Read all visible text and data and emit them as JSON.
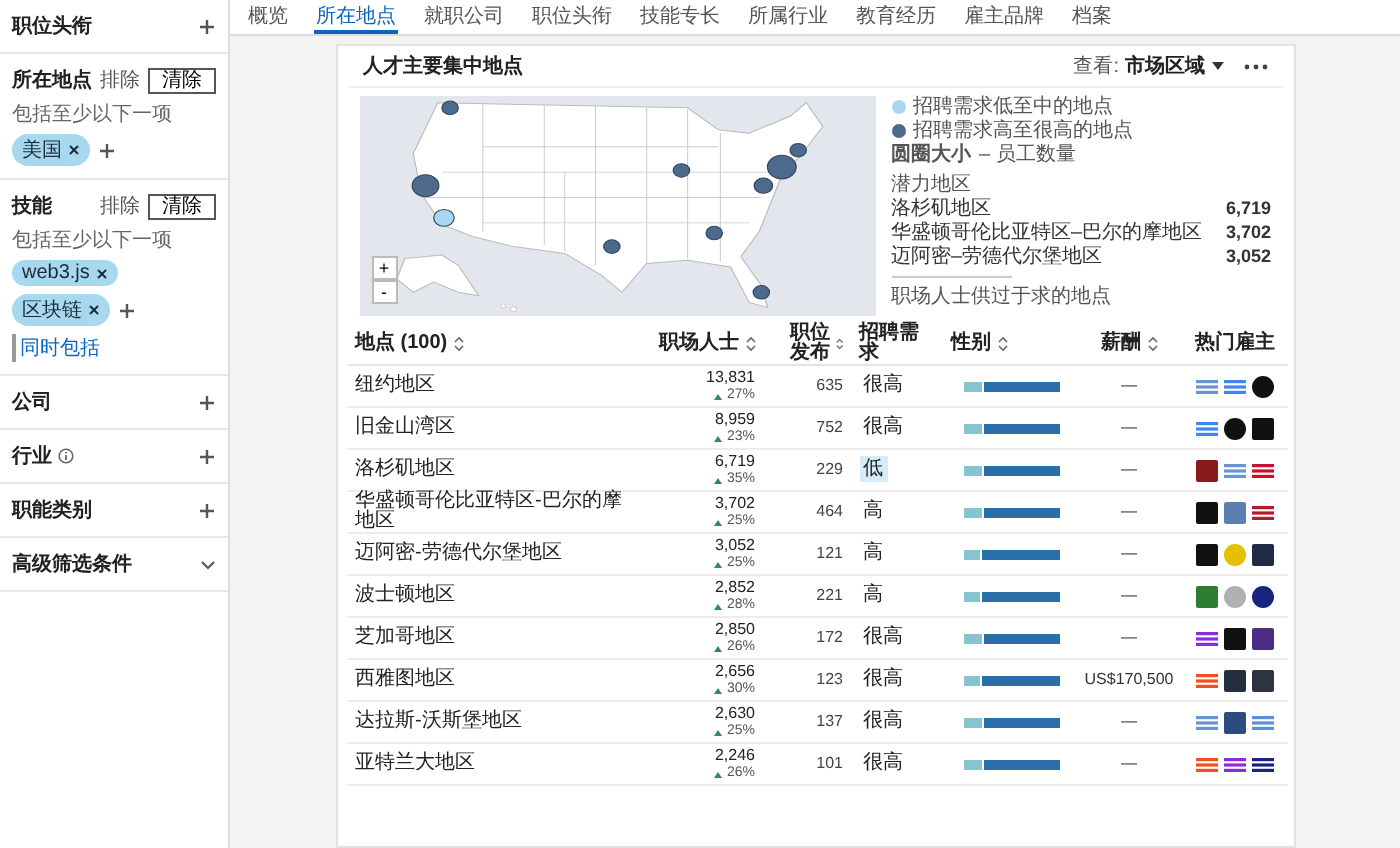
{
  "sidebar": {
    "sections": [
      {
        "kind": "add",
        "title": "职位头衔",
        "info": false
      },
      {
        "kind": "filter",
        "title": "所在地点",
        "exclude": "排除",
        "clear": "清除",
        "hint": "包括至少以下一项",
        "chips": [
          "美国"
        ]
      },
      {
        "kind": "filter",
        "title": "技能",
        "exclude": "排除",
        "clear": "清除",
        "hint": "包括至少以下一项",
        "chips": [
          "web3.js",
          "区块链"
        ],
        "also": "同时包括"
      },
      {
        "kind": "add",
        "title": "公司",
        "info": false
      },
      {
        "kind": "add",
        "title": "行业",
        "info": true
      },
      {
        "kind": "add",
        "title": "职能类别",
        "info": false
      },
      {
        "kind": "more",
        "title": "高级筛选条件"
      }
    ]
  },
  "tabs": [
    {
      "label": "概览",
      "selected": false
    },
    {
      "label": "所在地点",
      "selected": true
    },
    {
      "label": "就职公司",
      "selected": false
    },
    {
      "label": "职位头衔",
      "selected": false
    },
    {
      "label": "技能专长",
      "selected": false
    },
    {
      "label": "所属行业",
      "selected": false
    },
    {
      "label": "教育经历",
      "selected": false
    },
    {
      "label": "雇主品牌",
      "selected": false
    },
    {
      "label": "档案",
      "selected": false
    }
  ],
  "card": {
    "title": "人才主要集中地点",
    "view_label": "查看:",
    "view_value": "市场区域",
    "map": {
      "zoom_in": "+",
      "zoom_out": "-"
    },
    "legend": [
      {
        "label": "招聘需求低至中的地点",
        "color": "#a9d6f0"
      },
      {
        "label": "招聘需求高至很高的地点",
        "color": "#4d6a8c"
      }
    ],
    "size_note": "**圆圈大小** – 员工数量",
    "potential_title": "潜力地区",
    "potential": [
      {
        "name": "洛杉矶地区",
        "value": "6,719"
      },
      {
        "name": "华盛顿哥伦比亚特区–巴尔的摩地区",
        "value": "3,702"
      },
      {
        "name": "迈阿密–劳德代尔堡地区",
        "value": "3,052"
      }
    ],
    "oversupply": "职场人士供过于求的地点"
  },
  "table": {
    "columns": [
      {
        "label": "地点 (100)",
        "sortable": true
      },
      {
        "label": "职场人士",
        "sortable": true
      },
      {
        "label": "职位发布",
        "sortable": true
      },
      {
        "label": "招聘需求",
        "sortable": false
      },
      {
        "label": "性别",
        "sortable": true
      },
      {
        "label": "薪酬",
        "sortable": true
      },
      {
        "label": "热门雇主",
        "sortable": false
      }
    ],
    "rows": [
      {
        "location": "纽约地区",
        "professionals": "13,831",
        "change": "27%",
        "postings": "635",
        "demand": "很高",
        "highlighted": false,
        "level": 0.2,
        "salary": "—",
        "employers": [
          {
            "kind": "mark",
            "color": "#6b94d6"
          },
          {
            "kind": "mark",
            "color": "#4285f4"
          },
          {
            "kind": "round",
            "color": "#111111"
          }
        ]
      },
      {
        "location": "旧金山湾区",
        "professionals": "8,959",
        "change": "23%",
        "postings": "752",
        "demand": "很高",
        "highlighted": false,
        "level": 0.2,
        "salary": "—",
        "employers": [
          {
            "kind": "mark",
            "color": "#4285f4"
          },
          {
            "kind": "round",
            "color": "#111111"
          },
          {
            "kind": "tile",
            "color": "#111111"
          }
        ]
      },
      {
        "location": "洛杉矶地区",
        "professionals": "6,719",
        "change": "35%",
        "postings": "229",
        "demand": "低",
        "highlighted": true,
        "level": 0.2,
        "salary": "—",
        "employers": [
          {
            "kind": "tile",
            "color": "#8b1a1a"
          },
          {
            "kind": "mark",
            "color": "#6b94d6"
          },
          {
            "kind": "mark",
            "color": "#c8102e"
          }
        ]
      },
      {
        "location": "华盛顿哥伦比亚特区-巴尔的摩地区",
        "professionals": "3,702",
        "change": "25%",
        "postings": "464",
        "demand": "高",
        "highlighted": false,
        "level": 0.2,
        "salary": "—",
        "employers": [
          {
            "kind": "tile",
            "color": "#111111"
          },
          {
            "kind": "tile",
            "color": "#5a7fb0"
          },
          {
            "kind": "mark",
            "color": "#b01c2e"
          }
        ]
      },
      {
        "location": "迈阿密-劳德代尔堡地区",
        "professionals": "3,052",
        "change": "25%",
        "postings": "121",
        "demand": "高",
        "highlighted": false,
        "level": 0.17,
        "salary": "—",
        "employers": [
          {
            "kind": "tile",
            "color": "#111111"
          },
          {
            "kind": "round",
            "color": "#e6bf00"
          },
          {
            "kind": "tile",
            "color": "#1f2a44"
          }
        ]
      },
      {
        "location": "波士顿地区",
        "professionals": "2,852",
        "change": "28%",
        "postings": "221",
        "demand": "高",
        "highlighted": false,
        "level": 0.17,
        "salary": "—",
        "employers": [
          {
            "kind": "tile",
            "color": "#2e7d32"
          },
          {
            "kind": "round",
            "color": "#b0b0b0"
          },
          {
            "kind": "round",
            "color": "#1a237e"
          }
        ]
      },
      {
        "location": "芝加哥地区",
        "professionals": "2,850",
        "change": "26%",
        "postings": "172",
        "demand": "很高",
        "highlighted": false,
        "level": 0.2,
        "salary": "—",
        "employers": [
          {
            "kind": "mark",
            "color": "#8a2be2"
          },
          {
            "kind": "tile",
            "color": "#111111"
          },
          {
            "kind": "tile",
            "color": "#4b2e83"
          }
        ]
      },
      {
        "location": "西雅图地区",
        "professionals": "2,656",
        "change": "30%",
        "postings": "123",
        "demand": "很高",
        "highlighted": false,
        "level": 0.17,
        "salary": "US$170,500",
        "employers": [
          {
            "kind": "mark",
            "color": "#f25022"
          },
          {
            "kind": "tile",
            "color": "#232f3e"
          },
          {
            "kind": "tile",
            "color": "#2b3440"
          }
        ]
      },
      {
        "location": "达拉斯-沃斯堡地区",
        "professionals": "2,630",
        "change": "25%",
        "postings": "137",
        "demand": "很高",
        "highlighted": false,
        "level": 0.2,
        "salary": "—",
        "employers": [
          {
            "kind": "mark",
            "color": "#6b94d6"
          },
          {
            "kind": "tile",
            "color": "#2b4c7e"
          },
          {
            "kind": "mark",
            "color": "#5b8fd6"
          }
        ]
      },
      {
        "location": "亚特兰大地区",
        "professionals": "2,246",
        "change": "26%",
        "postings": "101",
        "demand": "很高",
        "highlighted": false,
        "level": 0.2,
        "salary": "—",
        "employers": [
          {
            "kind": "mark",
            "color": "#f25022"
          },
          {
            "kind": "mark",
            "color": "#8a2be2"
          },
          {
            "kind": "mark",
            "color": "#1a237e"
          }
        ]
      }
    ]
  }
}
